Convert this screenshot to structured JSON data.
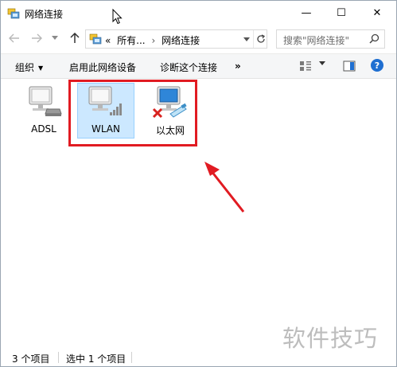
{
  "window": {
    "title": "网络连接",
    "controls": {
      "minimize": "—",
      "maximize": "☐",
      "close": "✕"
    }
  },
  "nav": {
    "back_icon": "arrow-left-icon",
    "forward_icon": "arrow-right-icon",
    "up_icon": "arrow-up-icon",
    "address": {
      "overflow": "«",
      "crumb_1": "所有...",
      "separator": "›",
      "crumb_2": "网络连接"
    },
    "search_placeholder": "搜索\"网络连接\""
  },
  "commands": {
    "organize": "组织",
    "enable_device": "启用此网络设备",
    "diagnose": "诊断这个连接",
    "more": "»"
  },
  "items": [
    {
      "label": "ADSL",
      "icon": "dialup-connection-icon",
      "selected": false
    },
    {
      "label": "WLAN",
      "icon": "wireless-connection-icon",
      "selected": true
    },
    {
      "label": "以太网",
      "icon": "ethernet-disconnected-icon",
      "selected": false
    }
  ],
  "annotation": {
    "color": "#e11b22"
  },
  "watermark": "软件技巧",
  "status": {
    "count": "3 个项目",
    "selected": "选中 1 个项目"
  },
  "colors": {
    "selection_bg": "#cce8ff",
    "selection_border": "#99d1ff",
    "accent": "#1f6fd1"
  }
}
